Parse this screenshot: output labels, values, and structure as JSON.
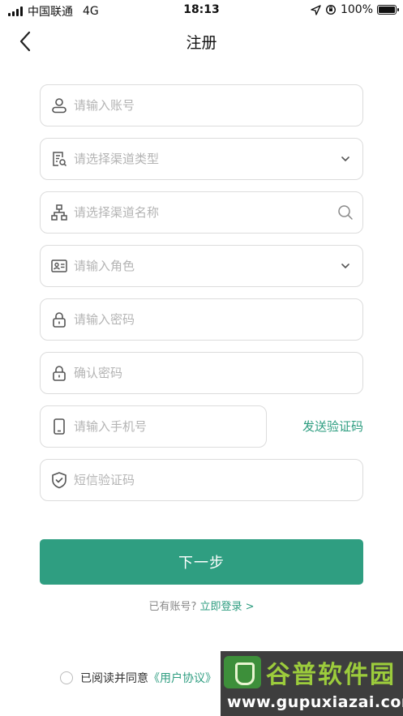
{
  "status_bar": {
    "carrier": "中国联通",
    "network": "4G",
    "time": "18:13",
    "battery": "100%",
    "battery_level": 1.0,
    "icons": [
      "signal-icon",
      "location-arrow-icon",
      "orientation-lock-icon",
      "battery-icon"
    ]
  },
  "nav": {
    "back_icon": "chevron-left-icon",
    "title": "注册"
  },
  "form": {
    "account": {
      "placeholder": "请输入账号",
      "icon": "user-icon"
    },
    "channel_type": {
      "placeholder": "请选择渠道类型",
      "icon": "document-search-icon",
      "trail_icon": "chevron-down-icon"
    },
    "channel_name": {
      "placeholder": "请选择渠道名称",
      "icon": "org-chart-icon",
      "trail_icon": "search-icon"
    },
    "role": {
      "placeholder": "请输入角色",
      "icon": "id-card-icon",
      "trail_icon": "chevron-down-icon"
    },
    "password": {
      "placeholder": "请输入密码",
      "icon": "lock-icon"
    },
    "confirm_password": {
      "placeholder": "确认密码",
      "icon": "lock-icon"
    },
    "phone": {
      "placeholder": "请输入手机号",
      "icon": "phone-icon"
    },
    "send_code": "发送验证码",
    "sms_code": {
      "placeholder": "短信验证码",
      "icon": "shield-check-icon"
    }
  },
  "actions": {
    "next": "下一步",
    "have_account": "已有账号?",
    "login_now": "立即登录 >"
  },
  "agreement": {
    "prefix": "已阅读并同意",
    "user_agreement": "《用户协议》",
    "checked": false
  },
  "watermark": {
    "title": "谷普软件园",
    "url": "www.gupuxiazai.com"
  },
  "colors": {
    "accent": "#2f9e81",
    "border": "#dcdcdc",
    "placeholder": "#b4b4b4"
  }
}
